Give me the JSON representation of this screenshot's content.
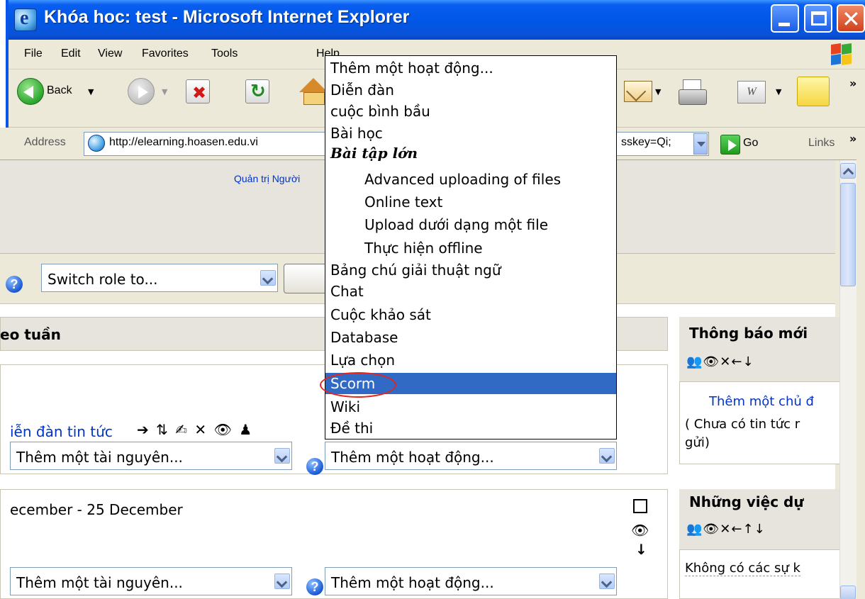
{
  "window": {
    "title": "Khóa hoc: test - Microsoft Internet Explorer"
  },
  "menu": [
    "File",
    "Edit",
    "View",
    "Favorites",
    "Tools",
    "Help"
  ],
  "toolbar": {
    "back_label": "Back",
    "icons": [
      "back-icon",
      "forward-icon",
      "stop-icon",
      "refresh-icon",
      "home-icon",
      "mail-icon",
      "print-icon",
      "word-icon",
      "note-icon"
    ]
  },
  "address": {
    "label": "Address",
    "url": "http://elearning.hoasen.edu.vi",
    "url_tail": "sskey=Qi;",
    "go_label": "Go",
    "links_label": "Links"
  },
  "page": {
    "admin_link": "Quản trị Người",
    "switch_role": "Switch role to...",
    "weeks_title": "eo tuần",
    "news_forum": "iễn đàn tin tức",
    "add_resource": "Thêm một tài nguyên...",
    "add_activity": "Thêm một hoạt động...",
    "week_dates": "ecember - 25 December"
  },
  "sidebar": {
    "news_title": "Thông báo mới",
    "news_add": "Thêm một chủ đ",
    "news_empty_line1": "( Chưa có tin tức r",
    "news_empty_line2": "gửi)",
    "upcoming_title": "Những việc dự",
    "upcoming_empty": "Không có các sự k"
  },
  "dropdown": {
    "items": [
      {
        "label": "Thêm một hoạt động..."
      },
      {
        "label": "Diễn đàn"
      },
      {
        "label": "cuộc bình bầu"
      },
      {
        "label": "Bài học"
      },
      {
        "label": "Bài tập lớn"
      },
      {
        "label": "Advanced uploading of files"
      },
      {
        "label": "Online text"
      },
      {
        "label": "Upload dưới dạng một file"
      },
      {
        "label": "Thực hiện offline"
      },
      {
        "label": "Bảng chú giải thuật ngữ"
      },
      {
        "label": "Chat"
      },
      {
        "label": "Cuộc khảo sát"
      },
      {
        "label": "Database"
      },
      {
        "label": "Lựa chọn"
      },
      {
        "label": "Scorm"
      },
      {
        "label": "Wiki"
      },
      {
        "label": "Đề thi"
      }
    ],
    "selected": "Scorm"
  },
  "colors": {
    "titlebar": "#0057e7",
    "selection": "#316ac5",
    "link": "#0033cc",
    "highlight_circle": "#e8231b"
  }
}
